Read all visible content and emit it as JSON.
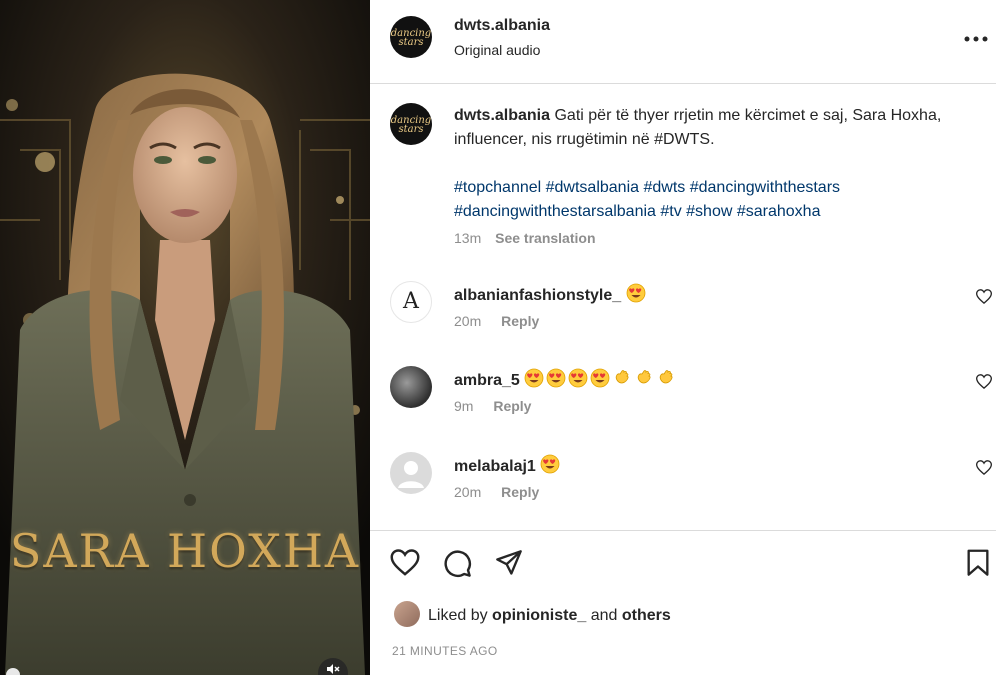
{
  "post": {
    "username": "dwts.albania",
    "audio": "Original audio",
    "more_icon": "ellipsis-icon",
    "logo_line1": "dancing",
    "logo_line2": "stars",
    "media": {
      "overlay_name": "SARA HOXHA",
      "mute_icon": "speaker-muted-icon"
    }
  },
  "caption": {
    "username": "dwts.albania",
    "text": "Gati për të thyer rrjetin me kërcimet e saj, Sara Hoxha, influencer, nis rrugëtimin në #DWTS.",
    "hashtags": "#topchannel #dwtsalbania #dwts #dancingwiththestars #dancingwiththestarsalbania #tv #show #sarahoxha",
    "time": "13m",
    "see_translation": "See translation"
  },
  "comments": [
    {
      "username": "albanianfashionstyle_",
      "emojis": [
        "heart-eyes"
      ],
      "time": "20m",
      "reply": "Reply",
      "avatar_letter": "A"
    },
    {
      "username": "ambra_5",
      "emojis": [
        "heart-eyes",
        "heart-eyes",
        "heart-eyes",
        "heart-eyes",
        "clap",
        "clap",
        "clap"
      ],
      "time": "9m",
      "reply": "Reply"
    },
    {
      "username": "melabalaj1",
      "emojis": [
        "heart-eyes"
      ],
      "time": "20m",
      "reply": "Reply"
    }
  ],
  "likes": {
    "prefix": "Liked by",
    "user": "opinioniste_",
    "middle": "and",
    "others": "others"
  },
  "timestamp": "21 MINUTES AGO",
  "colors": {
    "accent_gold": "#d2a85a",
    "hashtag_blue": "#00376b",
    "muted_text": "#8e8e8e",
    "divider": "#dbdbdb"
  }
}
